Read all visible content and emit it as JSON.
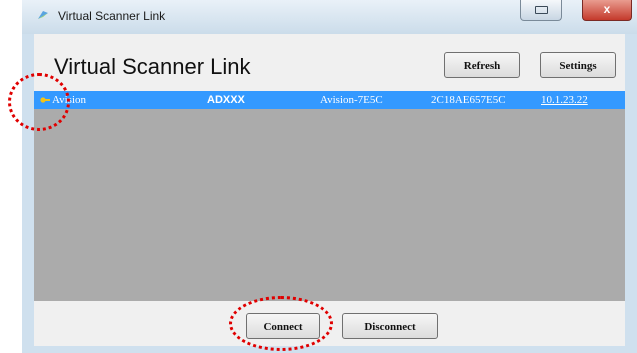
{
  "window": {
    "title": "Virtual Scanner Link",
    "close_glyph": "x"
  },
  "header": {
    "heading": "Virtual Scanner Link"
  },
  "toolbar": {
    "refresh_label": "Refresh",
    "settings_label": "Settings"
  },
  "devices": [
    {
      "name": "Avision",
      "model": "ADXXX",
      "hostname": "Avision-7E5C",
      "mac": "2C18AE657E5C",
      "ip": "10.1.23.22",
      "selected": true
    }
  ],
  "footer": {
    "connect_label": "Connect",
    "disconnect_label": "Disconnect"
  },
  "icons": {
    "app": "scanner-app-icon",
    "device": "key-icon"
  },
  "colors": {
    "selection": "#3399ff",
    "list_background": "#ababab",
    "highlight_ring": "#e00000"
  }
}
